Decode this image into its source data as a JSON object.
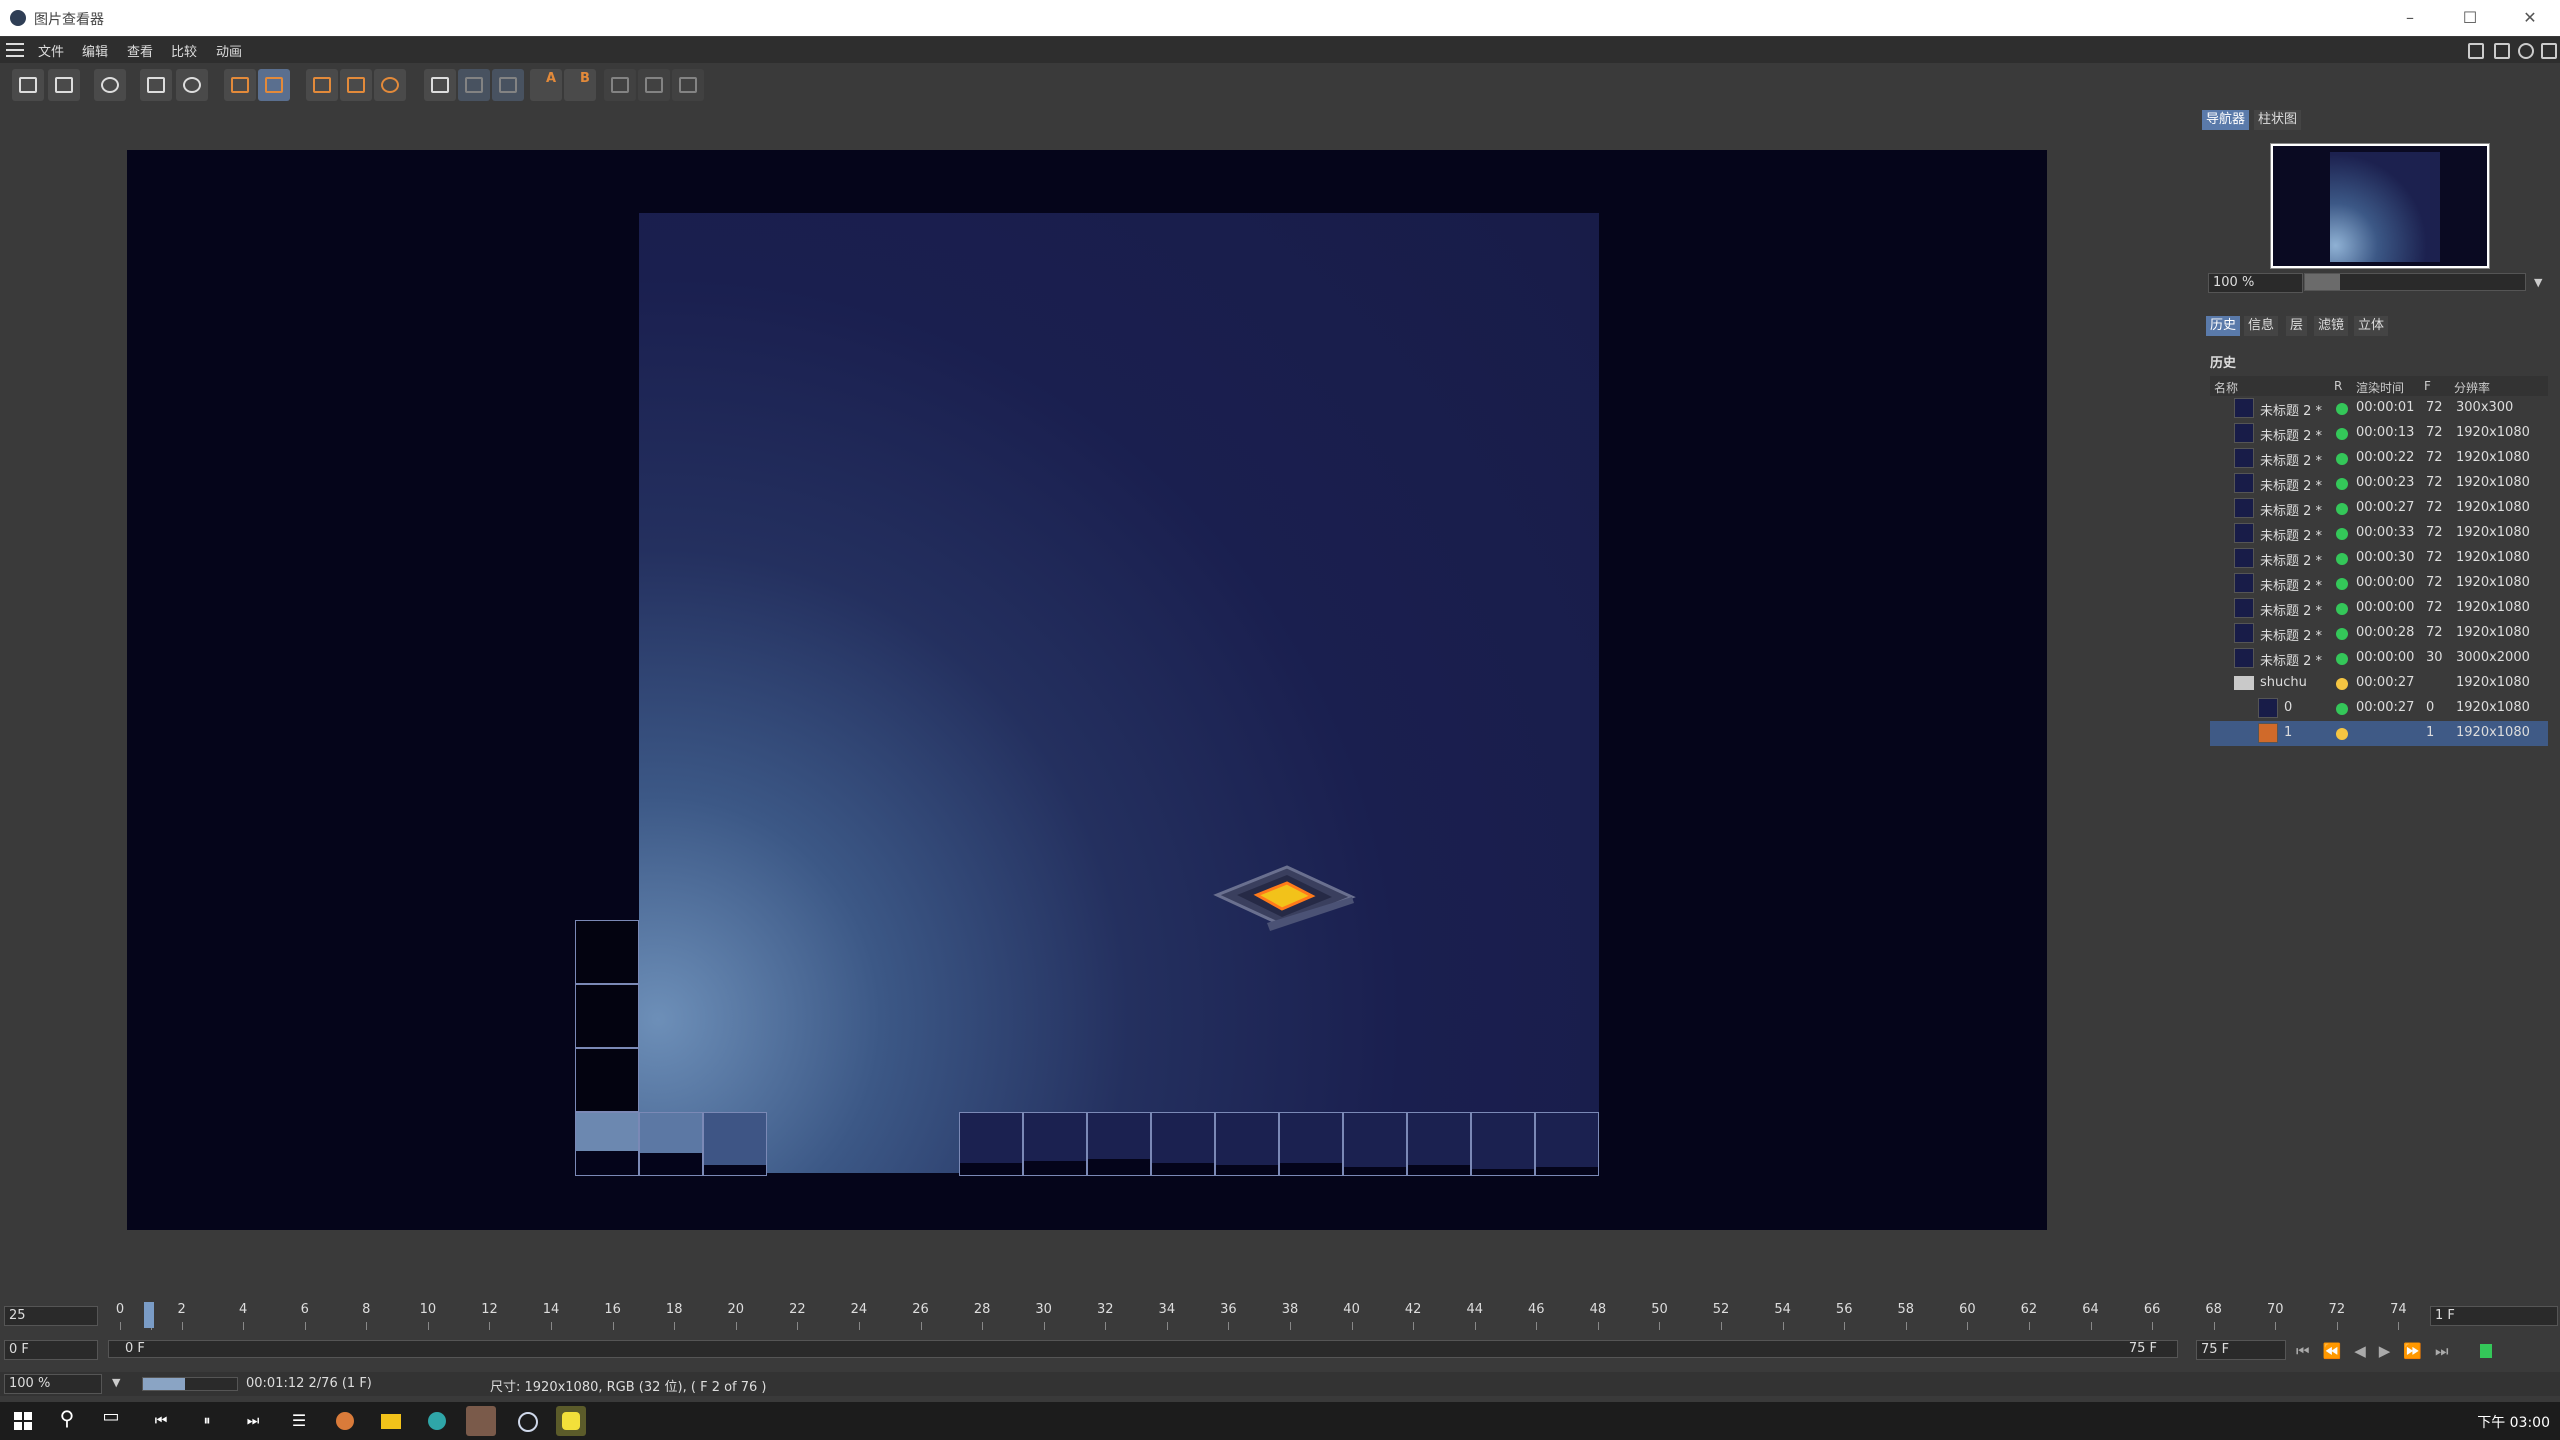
{
  "window": {
    "title": "图片查看器",
    "minimize": "–",
    "maximize": "☐",
    "close": "✕"
  },
  "menu": [
    "文件",
    "编辑",
    "查看",
    "比较",
    "动画"
  ],
  "toolbar": {
    "labels": [
      "A",
      "B"
    ]
  },
  "navigator": {
    "tabs": [
      "导航器",
      "柱状图"
    ],
    "zoom": "100 %",
    "zoom_fraction": 0.16
  },
  "panel_tabs": [
    "历史",
    "信息",
    "层",
    "滤镜",
    "立体"
  ],
  "history": {
    "title": "历史",
    "columns": [
      "名称",
      "R",
      "渲染时间",
      "F",
      "分辨率"
    ],
    "rows": [
      {
        "name": "未标题 2 *",
        "status": "green",
        "time": "00:00:01",
        "f": "72",
        "res": "300x300"
      },
      {
        "name": "未标题 2 *",
        "status": "green",
        "time": "00:00:13",
        "f": "72",
        "res": "1920x1080"
      },
      {
        "name": "未标题 2 *",
        "status": "green",
        "time": "00:00:22",
        "f": "72",
        "res": "1920x1080"
      },
      {
        "name": "未标题 2 *",
        "status": "green",
        "time": "00:00:23",
        "f": "72",
        "res": "1920x1080"
      },
      {
        "name": "未标题 2 *",
        "status": "green",
        "time": "00:00:27",
        "f": "72",
        "res": "1920x1080"
      },
      {
        "name": "未标题 2 *",
        "status": "green",
        "time": "00:00:33",
        "f": "72",
        "res": "1920x1080"
      },
      {
        "name": "未标题 2 *",
        "status": "green",
        "time": "00:00:30",
        "f": "72",
        "res": "1920x1080"
      },
      {
        "name": "未标题 2 *",
        "status": "green",
        "time": "00:00:00",
        "f": "72",
        "res": "1920x1080"
      },
      {
        "name": "未标题 2 *",
        "status": "green",
        "time": "00:00:00",
        "f": "72",
        "res": "1920x1080"
      },
      {
        "name": "未标题 2 *",
        "status": "green",
        "time": "00:00:28",
        "f": "72",
        "res": "1920x1080"
      },
      {
        "name": "未标题 2 *",
        "status": "green",
        "time": "00:00:00",
        "f": "30",
        "res": "3000x2000"
      },
      {
        "name": "shuchu",
        "status": "yellow",
        "time": "00:00:27",
        "f": "",
        "res": "1920x1080",
        "folder": true
      },
      {
        "name": "0",
        "status": "green",
        "time": "00:00:27",
        "f": "0",
        "res": "1920x1080",
        "child": true
      },
      {
        "name": "1",
        "status": "yellow",
        "time": "",
        "f": "1",
        "res": "1920x1080",
        "child": true,
        "selected": true
      }
    ]
  },
  "timeline": {
    "fps": "25",
    "current": "0 F",
    "start_label": "0 F",
    "end_label": "75 F",
    "end_field": "75 F",
    "step_field": "1 F",
    "ticks": [
      "0",
      "1",
      "2",
      "4",
      "6",
      "8",
      "10",
      "12",
      "14",
      "16",
      "18",
      "20",
      "22",
      "24",
      "26",
      "28",
      "30",
      "32",
      "34",
      "36",
      "38",
      "40",
      "42",
      "44",
      "46",
      "48",
      "50",
      "52",
      "54",
      "56",
      "58",
      "60",
      "62",
      "64",
      "66",
      "68",
      "70",
      "72",
      "74"
    ]
  },
  "status": {
    "zoom": "100 %",
    "progress_fraction": 0.45,
    "time": "00:01:12 2/76 (1 F)",
    "info": "尺寸: 1920x1080, RGB (32 位), ( F 2 of 76 )"
  },
  "taskbar": {
    "clock": "下午 03:00"
  },
  "colors": {
    "accent": "#5a7aaa",
    "green": "#34c759",
    "yellow": "#f5c542",
    "viewport": "#05051a"
  }
}
